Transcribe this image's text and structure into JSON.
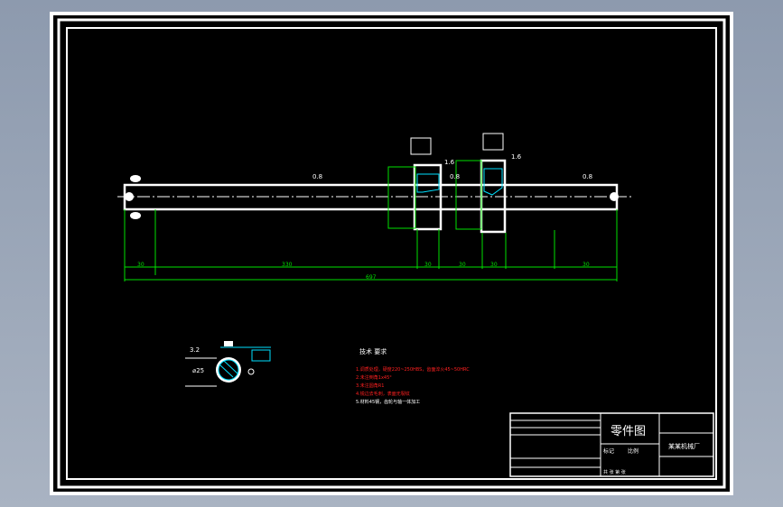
{
  "drawing": {
    "title_block": {
      "title": "零件图",
      "company": "某某机械厂",
      "row_label": "标记",
      "scale_label": "比例",
      "sheet_label": "共 张 第 张"
    },
    "tech_requirements": {
      "heading": "技术 要求",
      "lines": [
        "1.调质处理，硬度220~250HBS，齿面淬火45~50HRC",
        "2.未注倒角1x45°",
        "3.未注圆角R1",
        "4.锐边去毛刺，表面无裂纹",
        "5.材料45钢，齿轮与轴一体加工"
      ]
    },
    "roughness": [
      "0.8",
      "0.8",
      "1.6",
      "1.6",
      "0.8",
      "0.8",
      "3.2"
    ],
    "section": {
      "diameter_label": "⌀25",
      "roughness": "3.2"
    },
    "dimensions": {
      "total": "697",
      "segments": [
        "30",
        "330",
        "30",
        "30",
        "30",
        "30"
      ]
    }
  },
  "colors": {
    "background": "#000000",
    "geometry": "#ffffff",
    "dimension": "#00e000",
    "hatch": "#00e0ff",
    "notes": "#ff2020"
  }
}
